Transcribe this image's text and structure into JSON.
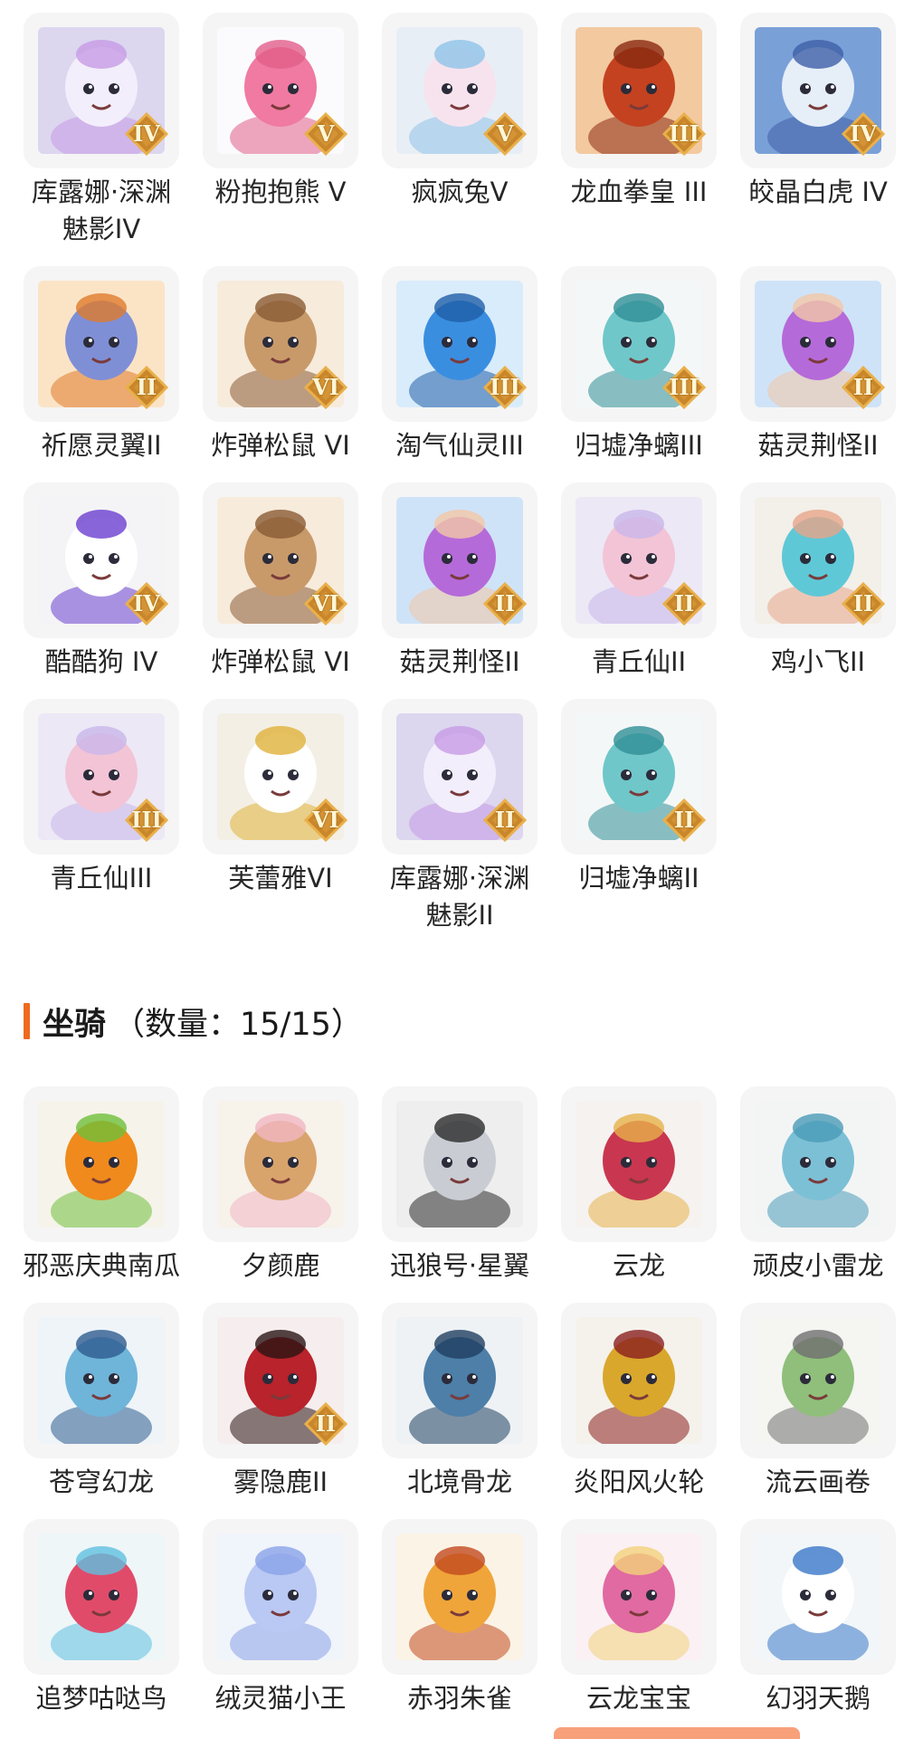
{
  "pets": [
    {
      "name": "库露娜·深渊魅影IV",
      "tier": "IV",
      "icon": "pet-kuluna-icon",
      "palette": [
        "#dcd6ef",
        "#f3eefb",
        "#c79be6"
      ]
    },
    {
      "name": "粉抱抱熊 V",
      "tier": "V",
      "icon": "pet-pink-bear-icon",
      "palette": [
        "#fbfbfd",
        "#f07aa1",
        "#e25f8a"
      ]
    },
    {
      "name": "疯疯兔V",
      "tier": "V",
      "icon": "pet-crazy-rabbit-icon",
      "palette": [
        "#e8eef5",
        "#f7e3ee",
        "#8fc3e8"
      ]
    },
    {
      "name": "龙血拳皇 III",
      "tier": "III",
      "icon": "pet-dragon-blood-fist-icon",
      "palette": [
        "#f3c9a0",
        "#c4421f",
        "#8a2a12"
      ]
    },
    {
      "name": "皎晶白虎 IV",
      "tier": "IV",
      "icon": "pet-white-tiger-icon",
      "palette": [
        "#7aa0d8",
        "#e6eef8",
        "#3f5fa8"
      ]
    },
    {
      "name": "祈愿灵翼II",
      "tier": "II",
      "icon": "pet-wish-wing-icon",
      "palette": [
        "#fbe4c6",
        "#7f8fd6",
        "#e07a2c"
      ]
    },
    {
      "name": "炸弹松鼠 VI",
      "tier": "VI",
      "icon": "pet-bomb-squirrel-icon",
      "palette": [
        "#f7ebdc",
        "#c89a6a",
        "#8a5b34"
      ]
    },
    {
      "name": "淘气仙灵III",
      "tier": "III",
      "icon": "pet-naughty-fairy-icon",
      "palette": [
        "#d9ecfb",
        "#3a8ee0",
        "#1f5fa8"
      ]
    },
    {
      "name": "归墟净螭III",
      "tier": "III",
      "icon": "pet-guixu-dragon-icon",
      "palette": [
        "#f4f7f8",
        "#6fc7c9",
        "#2f8f96"
      ]
    },
    {
      "name": "菇灵荆怪II",
      "tier": "II",
      "icon": "pet-mushroom-spirit-icon",
      "palette": [
        "#cfe3f8",
        "#b56ad9",
        "#f2c7a6"
      ]
    },
    {
      "name": "酷酷狗 IV",
      "tier": "IV",
      "icon": "pet-cool-dog-icon",
      "palette": [
        "#f4f4f6",
        "#ffffff",
        "#6b3fd1"
      ]
    },
    {
      "name": "炸弹松鼠 VI",
      "tier": "VI",
      "icon": "pet-bomb-squirrel-icon",
      "palette": [
        "#f7ebdc",
        "#c89a6a",
        "#8a5b34"
      ]
    },
    {
      "name": "菇灵荆怪II",
      "tier": "II",
      "icon": "pet-mushroom-spirit-icon",
      "palette": [
        "#cfe3f8",
        "#b56ad9",
        "#f2c7a6"
      ]
    },
    {
      "name": "青丘仙II",
      "tier": "II",
      "icon": "pet-qingqiu-fairy-icon",
      "palette": [
        "#ece8f6",
        "#f2c4d6",
        "#c9b7ea"
      ]
    },
    {
      "name": "鸡小飞II",
      "tier": "II",
      "icon": "pet-chick-flyer-icon",
      "palette": [
        "#f3efe9",
        "#5fc8d6",
        "#e7a58a"
      ]
    },
    {
      "name": "青丘仙III",
      "tier": "III",
      "icon": "pet-qingqiu-fairy-icon",
      "palette": [
        "#ece8f6",
        "#f2c4d6",
        "#c9b7ea"
      ]
    },
    {
      "name": "芙蕾雅VI",
      "tier": "VI",
      "icon": "pet-freya-icon",
      "palette": [
        "#f3efe4",
        "#ffffff",
        "#e0b23a"
      ]
    },
    {
      "name": "库露娜·深渊魅影II",
      "tier": "II",
      "icon": "pet-kuluna-icon",
      "palette": [
        "#dcd6ef",
        "#f3eefb",
        "#c79be6"
      ]
    },
    {
      "name": "归墟净螭II",
      "tier": "II",
      "icon": "pet-guixu-dragon-icon",
      "palette": [
        "#f4f7f8",
        "#6fc7c9",
        "#2f8f96"
      ]
    }
  ],
  "mounts_section": {
    "title": "坐骑",
    "count_text": "（数量：15/15）"
  },
  "mounts": [
    {
      "name": "邪恶庆典南瓜",
      "tier": "",
      "icon": "mount-evil-pumpkin-icon",
      "palette": [
        "#f6f3ea",
        "#f08a1c",
        "#6fbf3a"
      ]
    },
    {
      "name": "夕颜鹿",
      "tier": "",
      "icon": "mount-evening-deer-icon",
      "palette": [
        "#f7f2ea",
        "#d9a36c",
        "#f0b7c3"
      ]
    },
    {
      "name": "迅狼号·星翼",
      "tier": "",
      "icon": "mount-swift-wolf-icon",
      "palette": [
        "#eeeeee",
        "#c9cdd3",
        "#2a2a2a"
      ]
    },
    {
      "name": "云龙",
      "tier": "",
      "icon": "mount-cloud-dragon-icon",
      "palette": [
        "#f5f2f0",
        "#c9364f",
        "#e7b24a"
      ]
    },
    {
      "name": "顽皮小雷龙",
      "tier": "",
      "icon": "mount-naughty-thunder-dragon-icon",
      "palette": [
        "#f3f5f5",
        "#7cc0d6",
        "#4a9bb8"
      ]
    },
    {
      "name": "苍穹幻龙",
      "tier": "",
      "icon": "mount-sky-dragon-icon",
      "palette": [
        "#eef4f8",
        "#6fb4d9",
        "#2e5b8f"
      ]
    },
    {
      "name": "雾隐鹿II",
      "tier": "II",
      "icon": "mount-mist-deer-icon",
      "palette": [
        "#f6eeee",
        "#b8232c",
        "#2a1414"
      ]
    },
    {
      "name": "北境骨龙",
      "tier": "",
      "icon": "mount-north-bone-dragon-icon",
      "palette": [
        "#eef2f5",
        "#4d7fa8",
        "#1f3f60"
      ]
    },
    {
      "name": "炎阳风火轮",
      "tier": "",
      "icon": "mount-fire-wheel-icon",
      "palette": [
        "#f5f2ec",
        "#d9a72c",
        "#8a1f1f"
      ]
    },
    {
      "name": "流云画卷",
      "tier": "",
      "icon": "mount-cloud-scroll-icon",
      "palette": [
        "#f5f5f2",
        "#8fbf7a",
        "#6f6f6f"
      ]
    },
    {
      "name": "追梦咕哒鸟",
      "tier": "",
      "icon": "mount-dream-bird-icon",
      "palette": [
        "#eef6f8",
        "#e14b6a",
        "#5fc0e0"
      ]
    },
    {
      "name": "绒灵猫小王",
      "tier": "",
      "icon": "mount-fluffy-cat-icon",
      "palette": [
        "#f0f4fb",
        "#b9c9f3",
        "#8aa3e8"
      ]
    },
    {
      "name": "赤羽朱雀",
      "tier": "",
      "icon": "mount-vermilion-bird-icon",
      "palette": [
        "#fbf3e6",
        "#f0a53a",
        "#c24a1f"
      ]
    },
    {
      "name": "云龙宝宝",
      "tier": "",
      "icon": "mount-baby-cloud-dragon-icon",
      "palette": [
        "#fbf0f3",
        "#e06aa1",
        "#f2d27a"
      ]
    },
    {
      "name": "幻羽天鹅",
      "tier": "",
      "icon": "mount-phantom-swan-icon",
      "palette": [
        "#f2f6f8",
        "#ffffff",
        "#3a78c9"
      ]
    }
  ],
  "badge_colors": [
    "#c9862a",
    "#e9b04c"
  ]
}
